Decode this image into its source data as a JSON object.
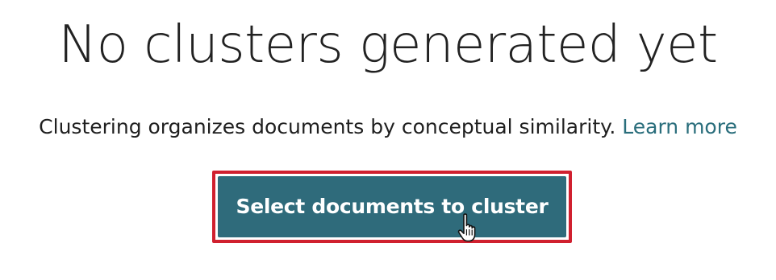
{
  "empty_state": {
    "heading": "No clusters generated yet",
    "description": "Clustering organizes documents by conceptual similarity.",
    "learn_more_link": "Learn more",
    "primary_button_label": "Select documents to cluster"
  },
  "icons": {
    "cursor": "hand-pointer-icon"
  },
  "colors": {
    "button_background": "#2f6b7b",
    "link": "#2a6e7c",
    "highlight_border": "#d0202f"
  }
}
